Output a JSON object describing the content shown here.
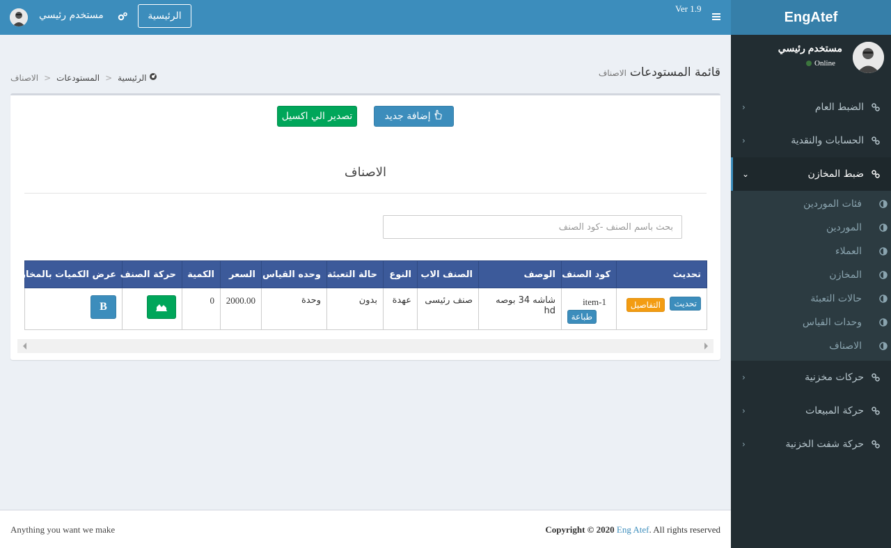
{
  "sidebar": {
    "logo": "EngAtef",
    "user_name": "مستخدم رئيسي",
    "user_status": "Online",
    "menu": [
      {
        "label": "الضبط العام"
      },
      {
        "label": "الحسابات والنقدية"
      },
      {
        "label": "ضبط المخازن"
      },
      {
        "label": "حركات مخزنية"
      },
      {
        "label": "حركة المبيعات"
      },
      {
        "label": "حركة شفت الخزنية"
      }
    ],
    "submenu": [
      {
        "label": "فئات الموردين"
      },
      {
        "label": "الموردين"
      },
      {
        "label": "العملاء"
      },
      {
        "label": "المخازن"
      },
      {
        "label": "حالات التعبئة"
      },
      {
        "label": "وحدات القياس"
      },
      {
        "label": "الاصناف"
      }
    ],
    "active_menu_index": 2
  },
  "header": {
    "version": "Ver 1.9",
    "home_button": "الرئيسية",
    "user_name": "مستخدم رئيسي"
  },
  "content_header": {
    "title": "قائمة المستودعات",
    "subtitle": "الاصناف",
    "breadcrumb": [
      "الرئيسية",
      "المستودعات",
      "الاصناف"
    ]
  },
  "box": {
    "add_button": "إضافة جديد",
    "export_button": "تصدير الي اكسيل",
    "title": "الاصناف",
    "search_placeholder": "بحث باسم الصنف -كود الصنف",
    "table": {
      "headers": [
        "تحديث",
        "كود الصنف",
        "الوصف",
        "الصنف الاب",
        "النوع",
        "حالة التعبئة",
        "وحده القياس",
        "السعر",
        "الكمية",
        "حركة الصنف",
        "عرض الكميات بالمخازن"
      ],
      "rows": [
        {
          "update_btn": "تحديث",
          "details_btn": "التفاصيل",
          "code": "item-1",
          "print_btn": "طباعة",
          "description": "شاشه 34 بوصه hd",
          "parent": "صنف رئيسى",
          "type": "عهدة",
          "packing": "بدون",
          "unit": "وحدة",
          "price": "2000.00",
          "qty": "0",
          "store_btn": "B"
        }
      ]
    }
  },
  "footer": {
    "left": "Anything you want we make",
    "copyright_label": "Copyright © 2020",
    "company": "Eng Atef",
    "rights": ". All rights reserved"
  },
  "colors": {
    "header": "#3c8dbc",
    "logo": "#367fa9",
    "sidebar": "#222d32",
    "table_header": "#3c5a9a",
    "success": "#00a65a",
    "warning": "#f39c12"
  }
}
